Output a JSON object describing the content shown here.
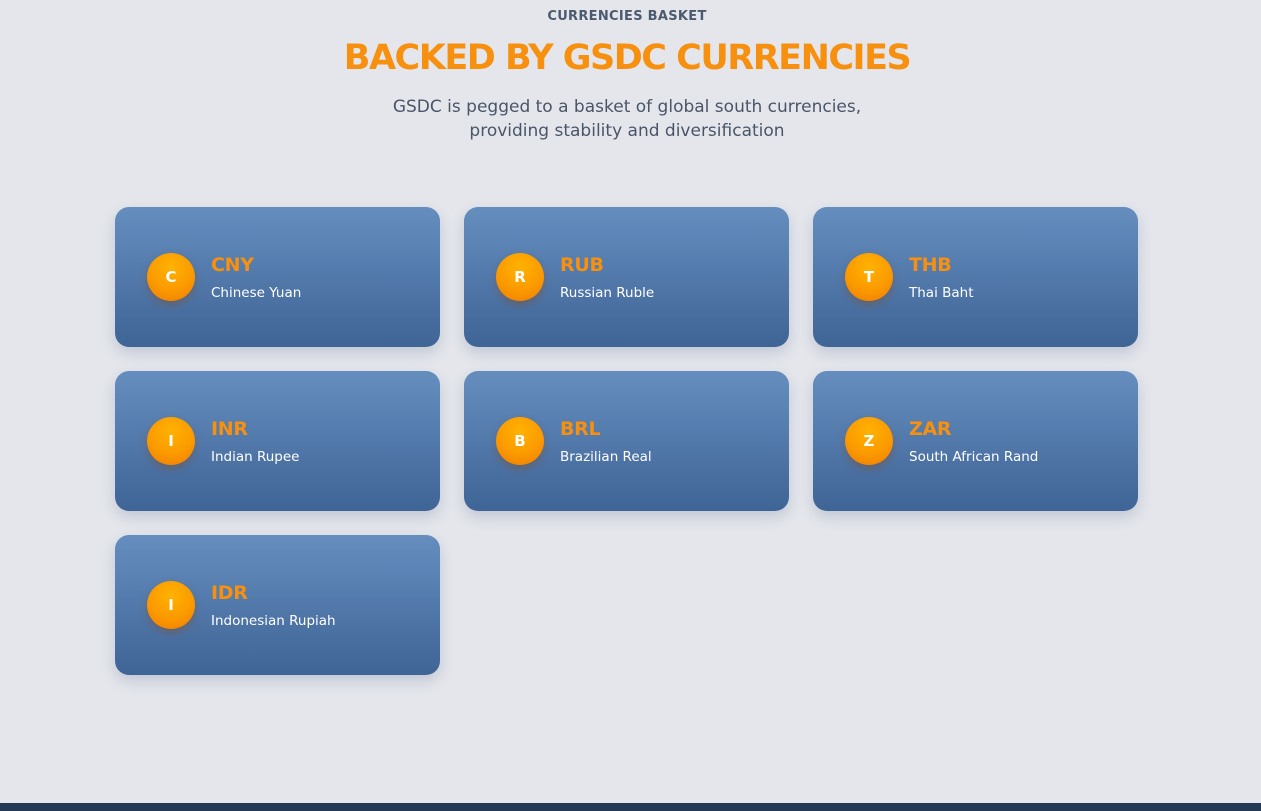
{
  "header": {
    "eyebrow": "CURRENCIES BASKET",
    "title": "BACKED BY GSDC CURRENCIES",
    "subtitle_line1": "GSDC is pegged to a basket of global south currencies,",
    "subtitle_line2": "providing stability and diversification"
  },
  "currencies": [
    {
      "initial": "C",
      "code": "CNY",
      "name": "Chinese Yuan"
    },
    {
      "initial": "R",
      "code": "RUB",
      "name": "Russian Ruble"
    },
    {
      "initial": "T",
      "code": "THB",
      "name": "Thai Baht"
    },
    {
      "initial": "I",
      "code": "INR",
      "name": "Indian Rupee"
    },
    {
      "initial": "B",
      "code": "BRL",
      "name": "Brazilian Real"
    },
    {
      "initial": "Z",
      "code": "ZAR",
      "name": "South African Rand"
    },
    {
      "initial": "I",
      "code": "IDR",
      "name": "Indonesian Rupiah"
    }
  ],
  "colors": {
    "accent": "#f7900e",
    "card_top": "#658ebf",
    "card_bottom": "#3f6496",
    "background": "#e4e6ec",
    "footer": "#223a55"
  }
}
